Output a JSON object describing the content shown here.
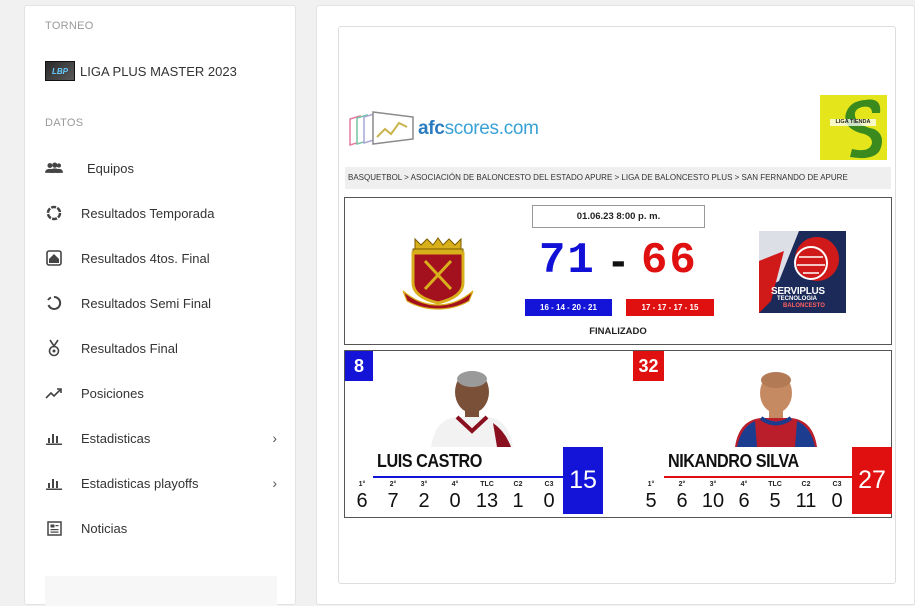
{
  "sidebar": {
    "torneo_title": "TORNEO",
    "tournament_name": "LIGA PLUS MASTER 2023",
    "datos_title": "DATOS",
    "items": [
      {
        "label": "Equipos",
        "icon": "group-icon"
      },
      {
        "label": "Resultados Temporada",
        "icon": "donut-icon"
      },
      {
        "label": "Resultados 4tos. Final",
        "icon": "house-icon"
      },
      {
        "label": "Resultados Semi Final",
        "icon": "refresh-icon"
      },
      {
        "label": "Resultados Final",
        "icon": "medal-icon"
      },
      {
        "label": "Posiciones",
        "icon": "trending-up-icon"
      },
      {
        "label": "Estadisticas",
        "icon": "bar-chart-icon",
        "chevron": true
      },
      {
        "label": "Estadisticas playoffs",
        "icon": "bar-chart-icon",
        "chevron": true
      },
      {
        "label": "Noticias",
        "icon": "newspaper-icon"
      }
    ]
  },
  "game": {
    "brand": {
      "afc": "afc",
      "scores": "scores.com"
    },
    "sponsor_text": "LIGA TIENDA",
    "breadcrumb": "BASQUETBOL  >  ASOCIACIÓN DE BALONCESTO DEL ESTADO APURE  >  LIGA DE BALONCESTO PLUS  >  SAN FERNANDO DE APURE",
    "datetime": "01.06.23  8:00 p. m.",
    "home_score": "71",
    "away_score": "66",
    "dash": "-",
    "home_quarters": "16  -  14  -  20  -  21",
    "away_quarters": "17  -  17  -  17  -  15",
    "status": "FINALIZADO",
    "away_team_text": "SERVIPLUS",
    "away_team_sub": "TECNOLOGIA",
    "away_team_sub2": "BALONCESTO",
    "colors": {
      "home": "#1414d8",
      "away": "#e01010"
    }
  },
  "players": {
    "stat_headers": [
      "1°",
      "2°",
      "3°",
      "4°",
      "TLC",
      "C2",
      "C3"
    ],
    "home": {
      "number": "8",
      "name": "LUIS CASTRO",
      "total": "15",
      "stats": [
        "6",
        "7",
        "2",
        "0",
        "13",
        "1",
        "0"
      ]
    },
    "away": {
      "number": "32",
      "name": "NIKANDRO SILVA",
      "total": "27",
      "stats": [
        "5",
        "6",
        "10",
        "6",
        "5",
        "11",
        "0"
      ]
    }
  }
}
